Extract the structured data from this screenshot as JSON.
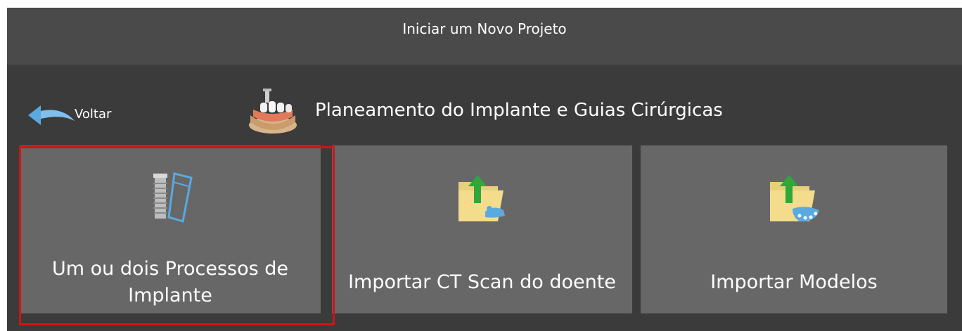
{
  "window": {
    "title": "Iniciar um Novo Projeto"
  },
  "nav": {
    "back_label": "Voltar",
    "back_icon": "back-arrow-icon"
  },
  "section": {
    "title": "Planeamento do Implante e Guias Cirúrgicas",
    "icon": "dental-implant-bridge-icon"
  },
  "tiles": [
    {
      "label_line1": "Um ou dois Processos de",
      "label_line2": "Implante",
      "icon": "implant-screw-icon",
      "selected": true
    },
    {
      "label": "Importar CT Scan do doente",
      "icon": "import-ct-folder-icon"
    },
    {
      "label": "Importar Modelos",
      "icon": "import-models-folder-icon"
    }
  ],
  "colors": {
    "window_bg": "#3b3b3b",
    "titlebar_bg": "#4a4a4a",
    "tile_bg": "#676767",
    "selection_border": "#d11414",
    "accent_blue": "#5aa9e0",
    "arrow_green": "#2fa83a"
  }
}
